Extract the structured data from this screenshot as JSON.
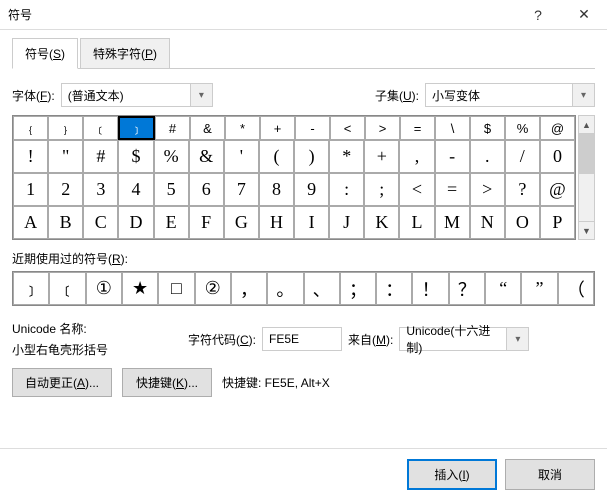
{
  "window": {
    "title": "符号",
    "help": "?",
    "close": "✕"
  },
  "tabs": {
    "symbols": "符号(S)",
    "special": "特殊字符(P)"
  },
  "font": {
    "label": "字体(F):",
    "value": "(普通文本)"
  },
  "subset": {
    "label": "子集(U):",
    "value": "小写变体"
  },
  "grid": {
    "row0": [
      "﹛",
      "﹜",
      "﹝",
      "﹞",
      "#",
      "&",
      "*",
      "+",
      "-",
      "<",
      ">",
      "=",
      "\\",
      "$",
      "%",
      "@"
    ],
    "row1": [
      "!",
      "\"",
      "#",
      "$",
      "%",
      "&",
      "'",
      "(",
      ")",
      "*",
      "+",
      ",",
      "-",
      ".",
      "/",
      "0"
    ],
    "row2": [
      "1",
      "2",
      "3",
      "4",
      "5",
      "6",
      "7",
      "8",
      "9",
      ":",
      ";",
      "<",
      "=",
      ">",
      "?",
      "@"
    ],
    "row3": [
      "A",
      "B",
      "C",
      "D",
      "E",
      "F",
      "G",
      "H",
      "I",
      "J",
      "K",
      "L",
      "M",
      "N",
      "O",
      "P"
    ]
  },
  "selected_index": 3,
  "recent": {
    "label": "近期使用过的符号(R):",
    "items": [
      "﹞",
      "﹝",
      "①",
      "★",
      "□",
      "②",
      "，",
      "。",
      "、",
      "；",
      "：",
      "！",
      "？",
      "“",
      "”",
      "（"
    ]
  },
  "unicode_name": {
    "label": "Unicode 名称:",
    "value": "小型右龟壳形括号"
  },
  "code": {
    "label": "字符代码(C):",
    "value": "FE5E"
  },
  "from": {
    "label": "来自(M):",
    "value": "Unicode(十六进制)"
  },
  "buttons": {
    "autocorrect": "自动更正(A)...",
    "shortcut": "快捷键(K)...",
    "shortcut_label": "快捷键: FE5E, Alt+X"
  },
  "bottom": {
    "insert": "插入(I)",
    "cancel": "取消"
  }
}
